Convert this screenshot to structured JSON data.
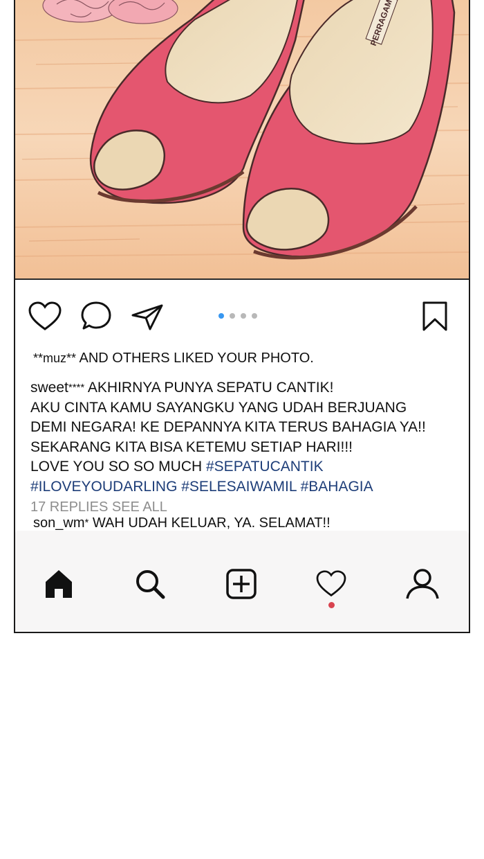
{
  "post": {
    "pager": {
      "count": 4,
      "active_index": 0
    },
    "likes_user": "**muz**",
    "likes_text": " AND OTHERS LIKED YOUR PHOTO.",
    "caption_user": "sweet",
    "caption_user_stars": "****",
    "caption_line1": " AKHIRNYA PUNYA SEPATU CANTIK!",
    "caption_line2": "AKU CINTA KAMU SAYANGKU YANG UDAH BERJUANG",
    "caption_line3": "DEMI NEGARA! KE DEPANNYA KITA TERUS BAHAGIA YA!!",
    "caption_line4": "SEKARANG KITA BISA KETEMU SETIAP HARI!!!",
    "caption_line5": "LOVE YOU SO SO MUCH ",
    "hashtags": [
      "#SEPATUCANTIK",
      "#ILOVEYOUDARLING",
      "#SELESAIWAMIL",
      "#BAHAGIA"
    ],
    "replies": "17 REPLIES SEE ALL",
    "comment_user": "son_wm",
    "comment_user_star": "*",
    "comment_text": " WAH UDAH KELUAR, YA. SELAMAT!!",
    "shoe_brand": "PERRAGAMO"
  },
  "icons": {
    "like": "heart-outline-icon",
    "comment": "speech-bubble-icon",
    "share": "paper-plane-icon",
    "save": "bookmark-icon",
    "home": "home-icon",
    "search": "search-icon",
    "add": "add-post-icon",
    "activity": "heart-icon",
    "profile": "profile-icon"
  },
  "colors": {
    "hashtag": "#1d3d78",
    "pager_active": "#3897f0",
    "pager_inactive": "#b8b8b8",
    "notification_dot": "#d8434f",
    "shoe": "#e4566f"
  }
}
